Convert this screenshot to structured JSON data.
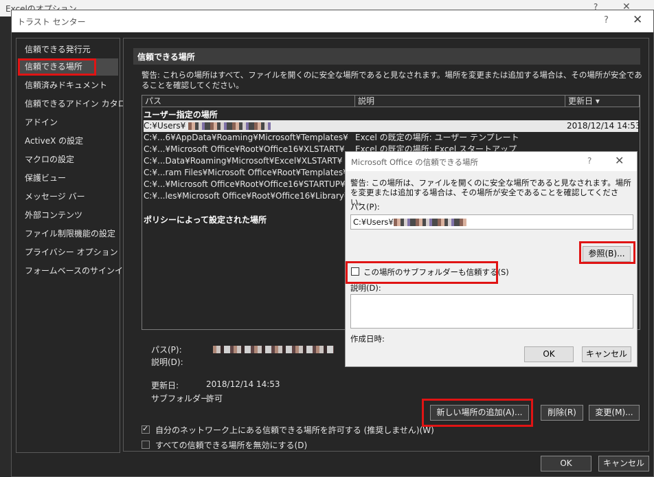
{
  "bg_window": {
    "title": "Excelのオプション",
    "help": "?",
    "close": "✕"
  },
  "window": {
    "title": "トラスト センター",
    "help": "?",
    "close": "✕"
  },
  "sidebar": {
    "items": [
      {
        "label": "信頼できる発行元"
      },
      {
        "label": "信頼できる場所",
        "selected": true
      },
      {
        "label": "信頼済みドキュメント"
      },
      {
        "label": "信頼できるアドイン カタログ"
      },
      {
        "label": "アドイン"
      },
      {
        "label": "ActiveX の設定"
      },
      {
        "label": "マクロの設定"
      },
      {
        "label": "保護ビュー"
      },
      {
        "label": "メッセージ バー"
      },
      {
        "label": "外部コンテンツ"
      },
      {
        "label": "ファイル制限機能の設定"
      },
      {
        "label": "プライバシー オプション"
      },
      {
        "label": "フォームベースのサインイン"
      }
    ]
  },
  "main": {
    "header": "信頼できる場所",
    "warning": "警告: これらの場所はすべて、ファイルを開くのに安全な場所であると見なされます。場所を変更または追加する場合は、その場所が安全であることを確認してください。",
    "columns": {
      "path": "パス",
      "description": "説明",
      "modified": "更新日 ▾"
    },
    "user_group": "ユーザー指定の場所",
    "user_rows": [
      {
        "path": "C:¥Users¥",
        "desc": "",
        "date": "2018/12/14 14:53",
        "selected": true
      },
      {
        "path": "C:¥...6¥AppData¥Roaming¥Microsoft¥Templates¥",
        "desc": "Excel の既定の場所: ユーザー テンプレート",
        "date": ""
      },
      {
        "path": "C:¥...¥Microsoft Office¥Root¥Office16¥XLSTART¥",
        "desc": "Excel の既定の場所: Excel スタートアップ",
        "date": ""
      },
      {
        "path": "C:¥...Data¥Roaming¥Microsoft¥Excel¥XLSTART¥",
        "desc": "",
        "date": ""
      },
      {
        "path": "C:¥...ram Files¥Microsoft Office¥Root¥Templates¥",
        "desc": "",
        "date": ""
      },
      {
        "path": "C:¥...¥Microsoft Office¥Root¥Office16¥STARTUP¥",
        "desc": "",
        "date": ""
      },
      {
        "path": "C:¥...les¥Microsoft Office¥Root¥Office16¥Library¥",
        "desc": "",
        "date": ""
      }
    ],
    "policy_group": "ポリシーによって設定された場所",
    "details": {
      "path_label": "パス(P):",
      "path_key": "P",
      "desc_label": "説明(D):",
      "modified_label": "更新日:",
      "modified_value": "2018/12/14 14:53",
      "subfolders_label": "サブフォルダー:",
      "subfolders_value": "許可"
    },
    "buttons": {
      "add": "新しい場所の追加(A)...",
      "remove": "削除(R)",
      "modify": "変更(M)..."
    },
    "allow_network": "自分のネットワーク上にある信頼できる場所を許可する (推奨しません)(W)",
    "allow_network_checked": true,
    "disable_all": "すべての信頼できる場所を無効にする(D)",
    "disable_all_checked": false
  },
  "footer": {
    "ok": "OK",
    "cancel": "キャンセル"
  },
  "dialog": {
    "title": "Microsoft Office の信頼できる場所",
    "help": "?",
    "close": "✕",
    "warning": "警告: この場所は、ファイルを開くのに安全な場所であると見なされます。場所を変更または追加する場合は、その場所が安全であることを確認してください。",
    "path_label": "パス(P):",
    "path_value": "C:¥Users¥",
    "browse": "参照(B)...",
    "subfolders": "この場所のサブフォルダーも信頼する(S)",
    "description_label": "説明(D):",
    "created_label": "作成日時:",
    "ok": "OK",
    "cancel": "キャンセル"
  }
}
